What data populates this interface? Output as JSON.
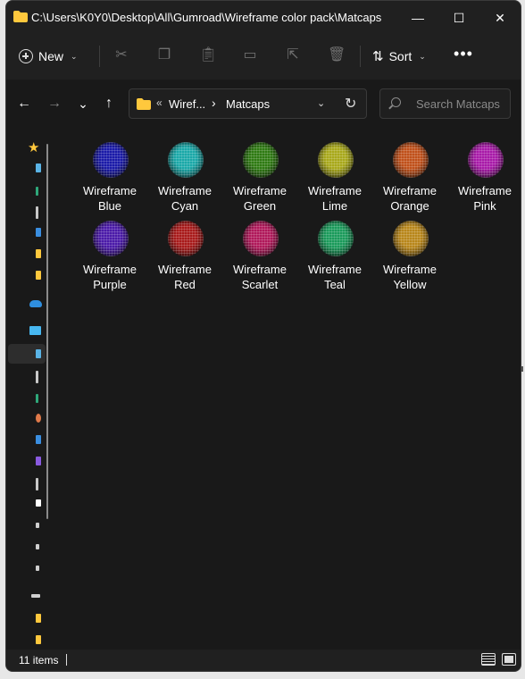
{
  "window": {
    "title": "C:\\Users\\K0Y0\\Desktop\\All\\Gumroad\\Wireframe color pack\\Matcaps",
    "minimize_glyph": "—",
    "maximize_glyph": "☐",
    "close_glyph": "✕"
  },
  "toolbar": {
    "new_label": "New",
    "sort_label": "Sort",
    "more_glyph": "•••",
    "icons": [
      "cut-icon",
      "copy-icon",
      "paste-icon",
      "rename-icon",
      "share-icon",
      "delete-icon"
    ]
  },
  "address": {
    "overflow_chevrons": "«",
    "crumb_parent": "Wiref...",
    "separator": "›",
    "crumb_current": "Matcaps",
    "search_placeholder": "Search Matcaps"
  },
  "nav_glyphs": {
    "back": "←",
    "forward": "→",
    "recent": "⌄",
    "up": "↑",
    "refresh": "↻",
    "dropdown": "⌄"
  },
  "files": [
    {
      "line1": "Wireframe",
      "line2": "Blue",
      "color": "#1a1aa8"
    },
    {
      "line1": "Wireframe",
      "line2": "Cyan",
      "color": "#1aa8a8"
    },
    {
      "line1": "Wireframe",
      "line2": "Green",
      "color": "#2e7a12"
    },
    {
      "line1": "Wireframe",
      "line2": "Lime",
      "color": "#a8a81a"
    },
    {
      "line1": "Wireframe",
      "line2": "Orange",
      "color": "#c0501a"
    },
    {
      "line1": "Wireframe",
      "line2": "Pink",
      "color": "#a81aa8"
    },
    {
      "line1": "Wireframe",
      "line2": "Purple",
      "color": "#4a1aa8"
    },
    {
      "line1": "Wireframe",
      "line2": "Red",
      "color": "#a81a1a"
    },
    {
      "line1": "Wireframe",
      "line2": "Scarlet",
      "color": "#b0185a"
    },
    {
      "line1": "Wireframe",
      "line2": "Teal",
      "color": "#1a9a5a"
    },
    {
      "line1": "Wireframe",
      "line2": "Yellow",
      "color": "#b8861a"
    }
  ],
  "status": {
    "item_count": "11 items"
  },
  "colors": {
    "background": "#202020",
    "body": "#191919",
    "folder": "#ffc83d"
  }
}
